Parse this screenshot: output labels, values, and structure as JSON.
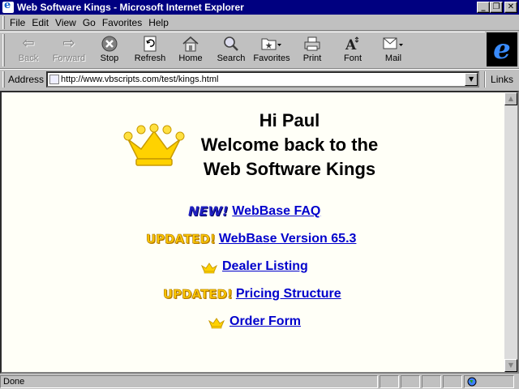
{
  "window": {
    "title": "Web Software Kings - Microsoft Internet Explorer",
    "controls": [
      "_",
      "❐",
      "✕"
    ]
  },
  "menu": [
    "File",
    "Edit",
    "View",
    "Go",
    "Favorites",
    "Help"
  ],
  "toolbar": {
    "back": "Back",
    "forward": "Forward",
    "stop": "Stop",
    "refresh": "Refresh",
    "home": "Home",
    "search": "Search",
    "favorites": "Favorites",
    "print": "Print",
    "font": "Font",
    "mail": "Mail"
  },
  "address": {
    "label": "Address",
    "url": "http://www.vbscripts.com/test/kings.html",
    "links_label": "Links"
  },
  "page": {
    "greeting": "Hi Paul",
    "welcome_line1": "Welcome back to the",
    "welcome_line2": "Web Software Kings",
    "badge_new": "NEW!",
    "badge_updated": "UPDATED!",
    "links": [
      {
        "badge": "new",
        "text": "WebBase FAQ"
      },
      {
        "badge": "updated",
        "text": "WebBase Version 65.3"
      },
      {
        "badge": "crown",
        "text": "Dealer Listing"
      },
      {
        "badge": "updated",
        "text": "Pricing Structure"
      },
      {
        "badge": "crown",
        "text": "Order Form"
      }
    ]
  },
  "status": {
    "text": "Done"
  },
  "colors": {
    "titlebar": "#000080",
    "link": "#0000cc",
    "page_background": "#fffff7",
    "crown": "#ffd200"
  }
}
